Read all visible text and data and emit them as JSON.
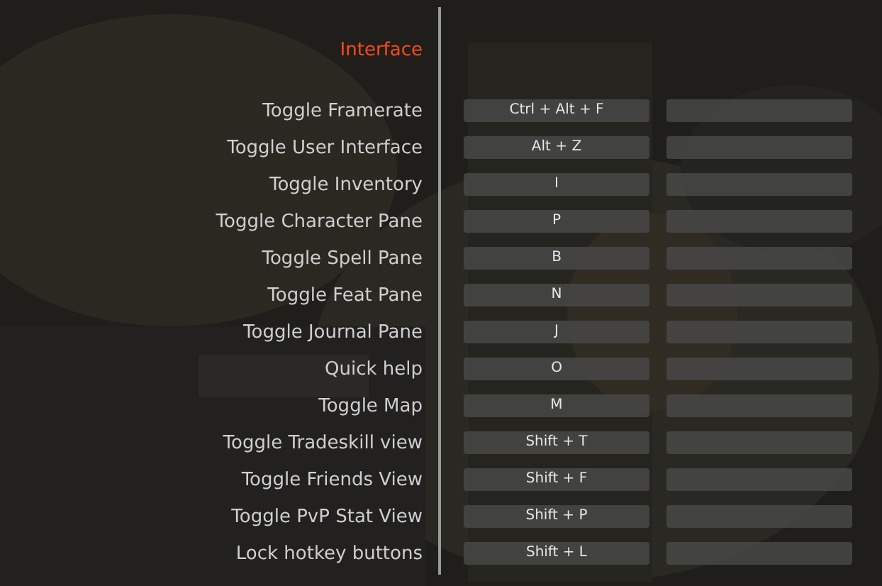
{
  "section_title": "Interface",
  "bindings": [
    {
      "action": "Toggle Framerate",
      "key": "Ctrl + Alt + F"
    },
    {
      "action": "Toggle User Interface",
      "key": "Alt + Z"
    },
    {
      "action": "Toggle Inventory",
      "key": "I"
    },
    {
      "action": "Toggle Character Pane",
      "key": "P"
    },
    {
      "action": "Toggle Spell Pane",
      "key": "B"
    },
    {
      "action": "Toggle Feat Pane",
      "key": "N"
    },
    {
      "action": "Toggle Journal Pane",
      "key": "J"
    },
    {
      "action": "Quick help",
      "key": "O"
    },
    {
      "action": "Toggle Map",
      "key": "M"
    },
    {
      "action": "Toggle Tradeskill view",
      "key": "Shift + T"
    },
    {
      "action": "Toggle Friends View",
      "key": "Shift + F"
    },
    {
      "action": "Toggle PvP Stat View",
      "key": "Shift + P"
    },
    {
      "action": "Lock hotkey buttons",
      "key": "Shift + L"
    }
  ]
}
